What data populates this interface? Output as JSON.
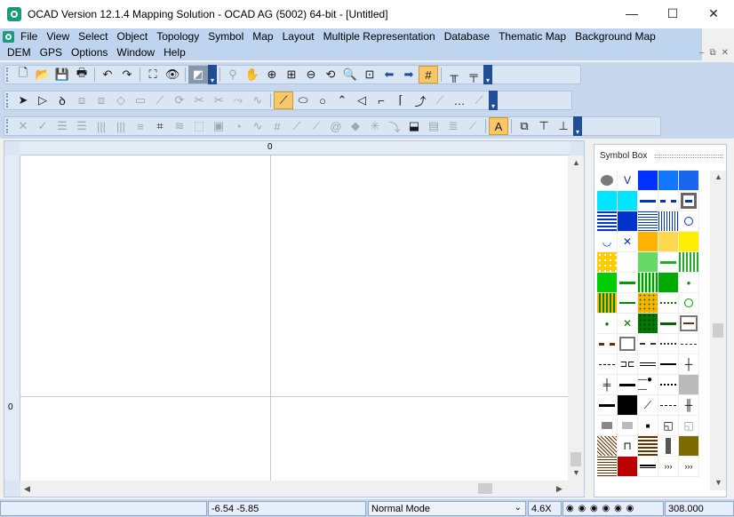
{
  "window": {
    "title": "OCAD Version 12.1.4  Mapping Solution - OCAD AG (5002) 64-bit - [Untitled]",
    "minimize": "—",
    "maximize": "☐",
    "close": "✕"
  },
  "menu": {
    "row1": [
      "File",
      "View",
      "Select",
      "Object",
      "Topology",
      "Symbol",
      "Map",
      "Layout",
      "Multiple Representation",
      "Database",
      "Thematic Map",
      "Background Map"
    ],
    "row2": [
      "DEM",
      "GPS",
      "Options",
      "Window",
      "Help"
    ]
  },
  "mdi": {
    "minimize": "–",
    "restore": "⧉",
    "close": "✕"
  },
  "ruler": {
    "top_zero": "0",
    "left_zero": "0"
  },
  "symbol_box": {
    "title": "Symbol Box"
  },
  "status": {
    "coords": "-6.54  -5.85",
    "mode": "Normal Mode",
    "zoom": "4.6X",
    "scale": "308.000"
  },
  "colors": {
    "menubar": "#bfd4ee",
    "accent": "#1f4e97",
    "selected": "#f7c76a"
  },
  "icons": {
    "toolbar1": [
      "new-file-icon",
      "open-folder-icon",
      "save-icon",
      "print-icon",
      "undo-icon",
      "redo-icon",
      "fullscreen-icon",
      "preview-icon",
      "convert-icon",
      "binoculars-icon",
      "hand-icon",
      "zoom-in-icon",
      "zoom-fit-icon",
      "zoom-out-icon",
      "zoom-prev-icon",
      "zoom-window-icon",
      "zoom-select-icon",
      "arrow-left-icon",
      "arrow-right-icon",
      "grid-icon",
      "ruler-icon",
      "measure-icon"
    ],
    "toolbar2": [
      "edit-object-icon",
      "edit-point-icon",
      "lasso-icon",
      "curve-icon",
      "ellipse-icon",
      "circle-icon",
      "polygon-icon",
      "bezier-icon",
      "straight-line-icon",
      "stairs-icon",
      "freehand-icon",
      "dotted-line-icon",
      "dash-line-icon"
    ],
    "toolbar3": [
      "cut-icon",
      "rotate-icon",
      "align-icon",
      "crop-icon",
      "merge-icon",
      "union-icon",
      "intersect-icon",
      "subtract-icon"
    ]
  }
}
